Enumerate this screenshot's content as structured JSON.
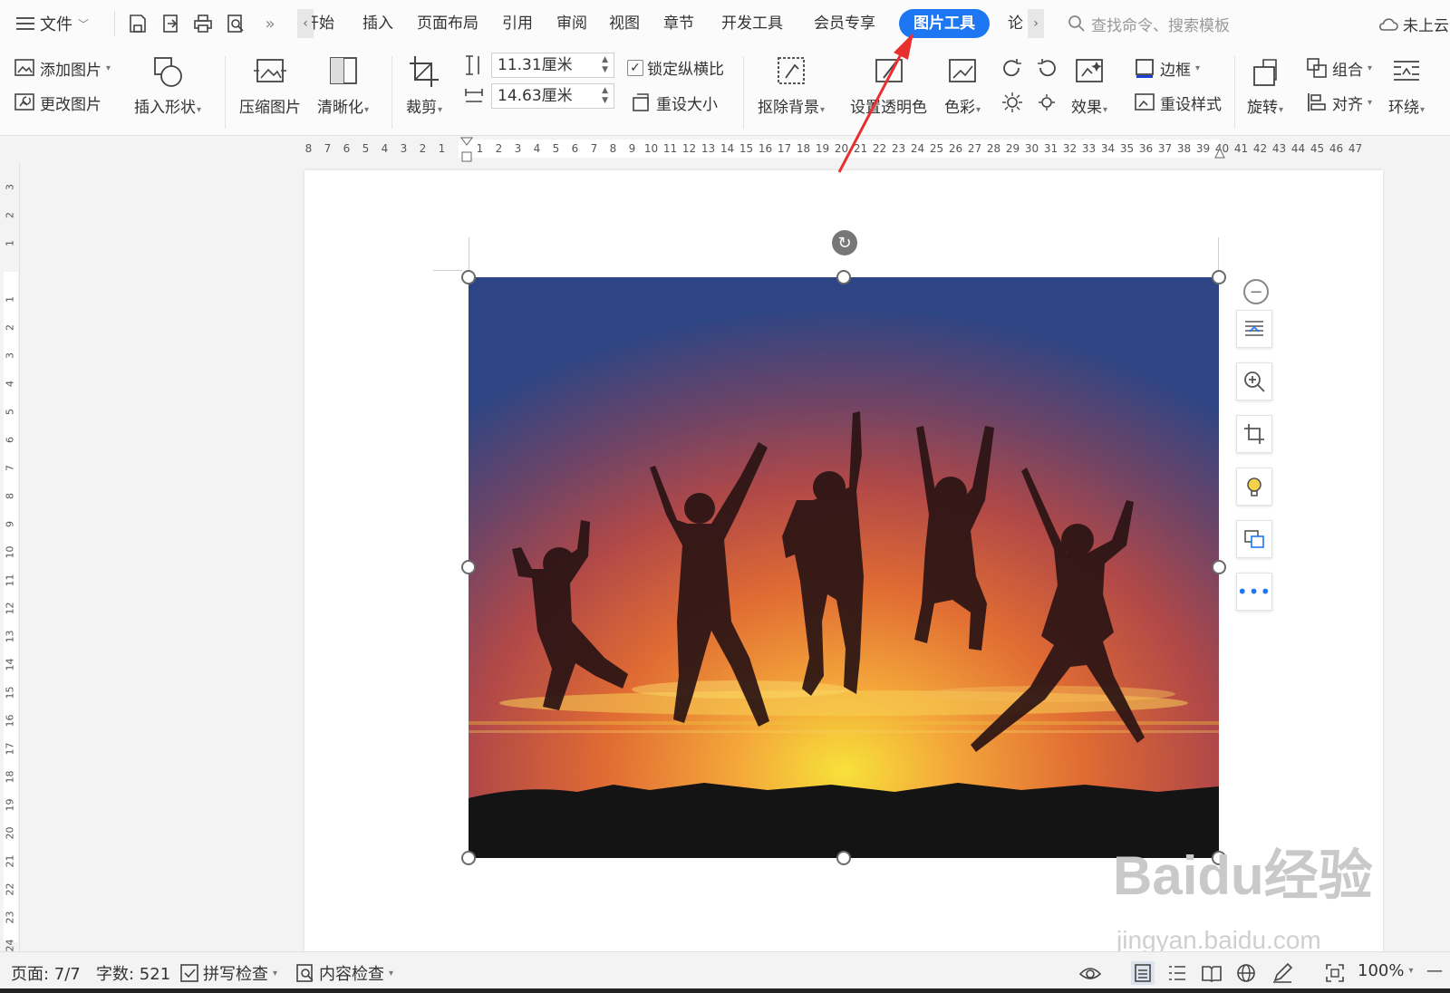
{
  "menu": {
    "file_label": "文件"
  },
  "tabs": [
    "开始",
    "插入",
    "页面布局",
    "引用",
    "审阅",
    "视图",
    "章节",
    "开发工具",
    "会员专享",
    "图片工具",
    "论"
  ],
  "active_tab": "图片工具",
  "search": {
    "placeholder": "查找命令、搜索模板"
  },
  "cloud": {
    "label": "未上云"
  },
  "ribbon": {
    "add_picture": "添加图片",
    "change_picture": "更改图片",
    "insert_shape": "插入形状",
    "compress_picture": "压缩图片",
    "sharpen": "清晰化",
    "crop": "裁剪",
    "height_value": "11.31厘米",
    "width_value": "14.63厘米",
    "lock_ratio": "锁定纵横比",
    "reset_size": "重设大小",
    "remove_background": "抠除背景",
    "set_transparent": "设置透明色",
    "color": "色彩",
    "effects": "效果",
    "border": "边框",
    "reset_style": "重设样式",
    "rotate": "旋转",
    "group": "组合",
    "align": "对齐",
    "wrap": "环绕"
  },
  "ruler": {
    "h_labels": [
      "8",
      "7",
      "6",
      "5",
      "4",
      "3",
      "2",
      "1",
      "",
      "1",
      "2",
      "3",
      "4",
      "5",
      "6",
      "7",
      "8",
      "9",
      "10",
      "11",
      "12",
      "13",
      "14",
      "15",
      "16",
      "17",
      "18",
      "19",
      "20",
      "21",
      "22",
      "23",
      "24",
      "25",
      "26",
      "27",
      "28",
      "29",
      "30",
      "31",
      "32",
      "33",
      "34",
      "35",
      "36",
      "37",
      "38",
      "39",
      "40",
      "41",
      "42",
      "43",
      "44",
      "45",
      "46",
      "47"
    ],
    "v_labels": [
      "3",
      "2",
      "1",
      "",
      "1",
      "2",
      "3",
      "4",
      "5",
      "6",
      "7",
      "8",
      "9",
      "10",
      "11",
      "12",
      "13",
      "14",
      "15",
      "16",
      "17",
      "18",
      "19",
      "20",
      "21",
      "22",
      "23",
      "24"
    ]
  },
  "watermark": {
    "logo": "Baidu经验",
    "url": "jingyan.baidu.com"
  },
  "status": {
    "page": "页面: 7/7",
    "word_count": "字数: 521",
    "spell_check": "拼写检查",
    "content_check": "内容检查",
    "zoom": "100%"
  },
  "colors": {
    "accent": "#1d77f2",
    "annotation": "#e8312f"
  }
}
